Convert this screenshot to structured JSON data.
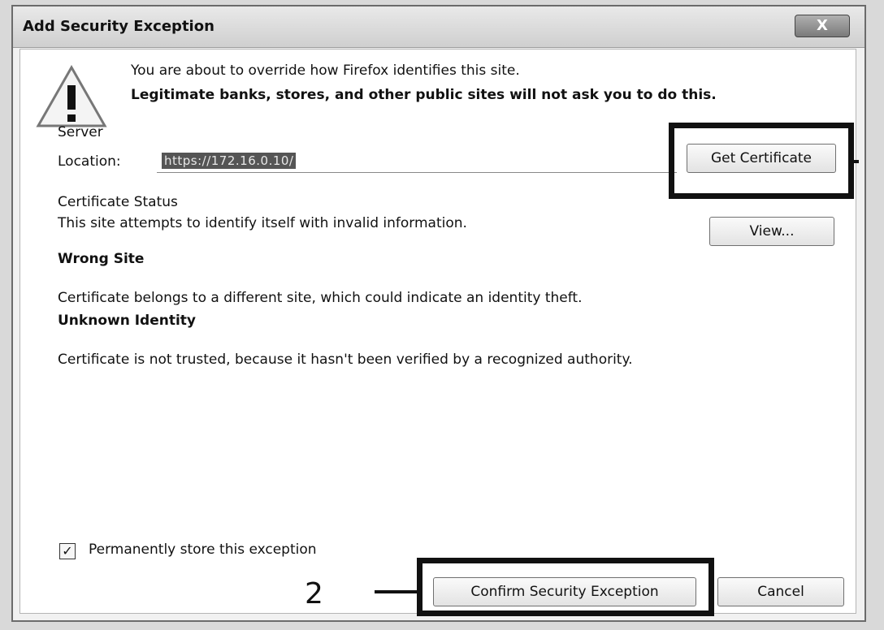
{
  "dialog": {
    "title": "Add Security Exception",
    "close_label": "X"
  },
  "warning": {
    "line1": "You are about to override how Firefox identifies this site.",
    "line2": "Legitimate banks, stores, and other public sites will not ask you to do this."
  },
  "server": {
    "heading": "Server",
    "location_label": "Location:",
    "location_value": "https://172.16.0.10/",
    "get_certificate_label": "Get Certificate"
  },
  "certificate_status": {
    "heading": "Certificate Status",
    "description": "This site attempts to identify itself with invalid information.",
    "view_label": "View...",
    "wrong_site_heading": "Wrong Site",
    "wrong_site_text": "Certificate belongs to a different site, which could indicate an identity theft.",
    "unknown_identity_heading": "Unknown Identity",
    "unknown_identity_text": "Certificate is not trusted, because it hasn't been verified by a recognized authority."
  },
  "permanent": {
    "label": "Permanently store this exception",
    "checked": true,
    "check_mark": "✓"
  },
  "footer": {
    "confirm_label": "Confirm Security Exception",
    "cancel_label": "Cancel",
    "step_number": "2"
  }
}
